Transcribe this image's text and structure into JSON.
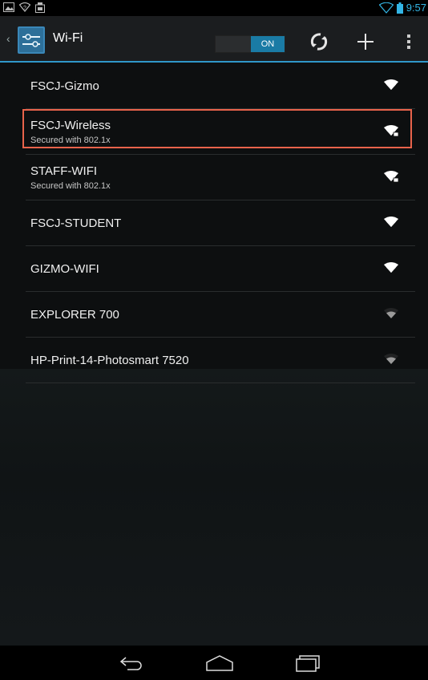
{
  "status_bar": {
    "time": "9:57",
    "icons": [
      "image-icon",
      "wifi-question-icon",
      "notification-icon",
      "wifi-signal-icon",
      "battery-icon"
    ]
  },
  "action_bar": {
    "title": "Wi-Fi",
    "toggle_label": "ON",
    "accent_color": "#33b5e5",
    "buttons": [
      "wps-icon",
      "add-network-icon",
      "overflow-menu-icon"
    ]
  },
  "networks": [
    {
      "name": "FSCJ-Gizmo",
      "subtitle": "",
      "secured": false,
      "strength": "strong"
    },
    {
      "name": "FSCJ-Wireless",
      "subtitle": "Secured with 802.1x",
      "secured": true,
      "strength": "strong",
      "highlighted": true
    },
    {
      "name": "STAFF-WIFI",
      "subtitle": "Secured with 802.1x",
      "secured": true,
      "strength": "strong"
    },
    {
      "name": "FSCJ-STUDENT",
      "subtitle": "",
      "secured": false,
      "strength": "strong"
    },
    {
      "name": "GIZMO-WIFI",
      "subtitle": "",
      "secured": false,
      "strength": "strong"
    },
    {
      "name": "EXPLORER 700",
      "subtitle": "",
      "secured": false,
      "strength": "weak"
    },
    {
      "name": "HP-Print-14-Photosmart 7520",
      "subtitle": "",
      "secured": false,
      "strength": "weak"
    }
  ],
  "nav_bar": {
    "buttons": [
      "back-icon",
      "home-icon",
      "recent-apps-icon"
    ]
  },
  "colors": {
    "highlight_border": "#e8634b",
    "actionbar_underline": "#2f97c9"
  }
}
